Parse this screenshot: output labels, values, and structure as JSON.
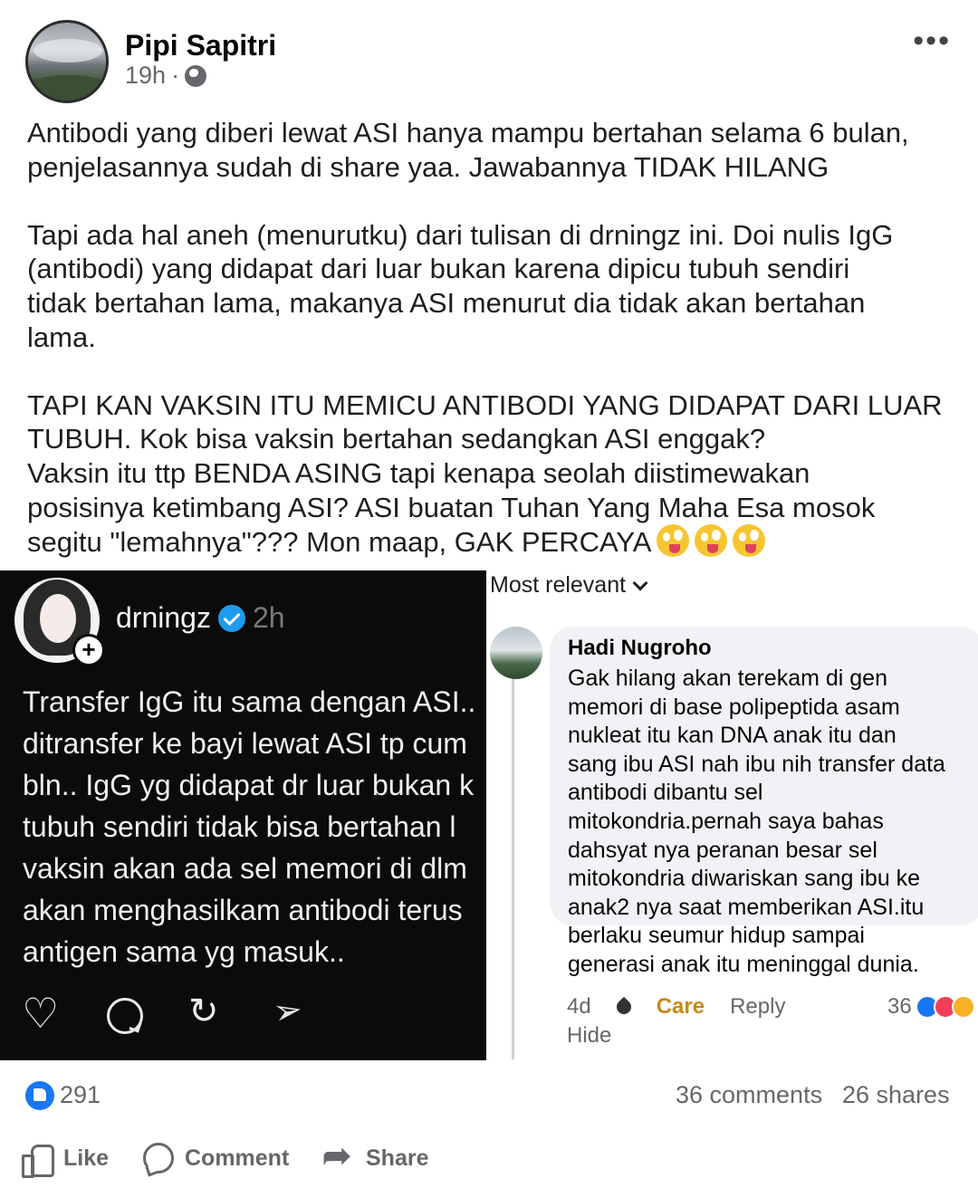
{
  "post": {
    "author": "Pipi Sapitri",
    "time": "19h",
    "separator": "·",
    "menu_label": "•••",
    "paragraphs": [
      "Antibodi yang diberi lewat ASI hanya mampu bertahan selama 6 bulan,\npenjelasannya sudah di share yaa. Jawabannya TIDAK HILANG",
      "Tapi ada hal aneh (menurutku) dari tulisan di drningz ini. Doi nulis IgG\n(antibodi) yang didapat dari luar bukan karena dipicu tubuh sendiri\ntidak bertahan lama, makanya ASI menurut dia tidak akan bertahan\nlama.",
      "TAPI KAN VAKSIN ITU MEMICU ANTIBODI YANG DIDAPAT DARI LUAR\nTUBUH. Kok bisa vaksin bertahan sedangkan ASI enggak?\nVaksin itu ttp BENDA ASING tapi kenapa seolah diistimewakan\nposisinya ketimbang ASI? ASI buatan Tuhan Yang Maha Esa mosok\nsegitu \"lemahnya\"??? Mon maap, GAK PERCAYA"
    ]
  },
  "embedded_post": {
    "username": "drningz",
    "time": "2h",
    "lines": [
      "Transfer IgG itu sama dengan ASI..",
      "ditransfer ke bayi lewat ASI tp cum",
      "bln.. IgG yg didapat dr luar bukan k",
      "tubuh sendiri tidak bisa bertahan l",
      "vaksin akan ada sel memori di dlm",
      "akan menghasilkam antibodi terus",
      "antigen sama yg masuk.."
    ]
  },
  "comments": {
    "sort_label": "Most relevant",
    "items": [
      {
        "name": "Hadi Nugroho",
        "text": "Gak hilang akan terekam di gen\nmemori di base polipeptida asam\nnukleat itu kan DNA anak itu dan\nsang ibu ASI nah ibu nih transfer data\nantibodi dibantu sel\nmitokondria.pernah saya bahas\ndahsyat nya peranan besar sel\nmitokondria diwariskan sang ibu ke\nanak2 nya saat memberikan ASI.itu\nberlaku seumur hidup sampai\ngenerasi anak itu meninggal dunia.",
        "age": "4d",
        "reaction_label": "Care",
        "reply_label": "Reply",
        "hide_label": "Hide",
        "reaction_count": "36"
      }
    ]
  },
  "stats": {
    "likes": "291",
    "comments": "36 comments",
    "shares": "26 shares"
  },
  "actions": {
    "like": "Like",
    "comment": "Comment",
    "share": "Share"
  }
}
